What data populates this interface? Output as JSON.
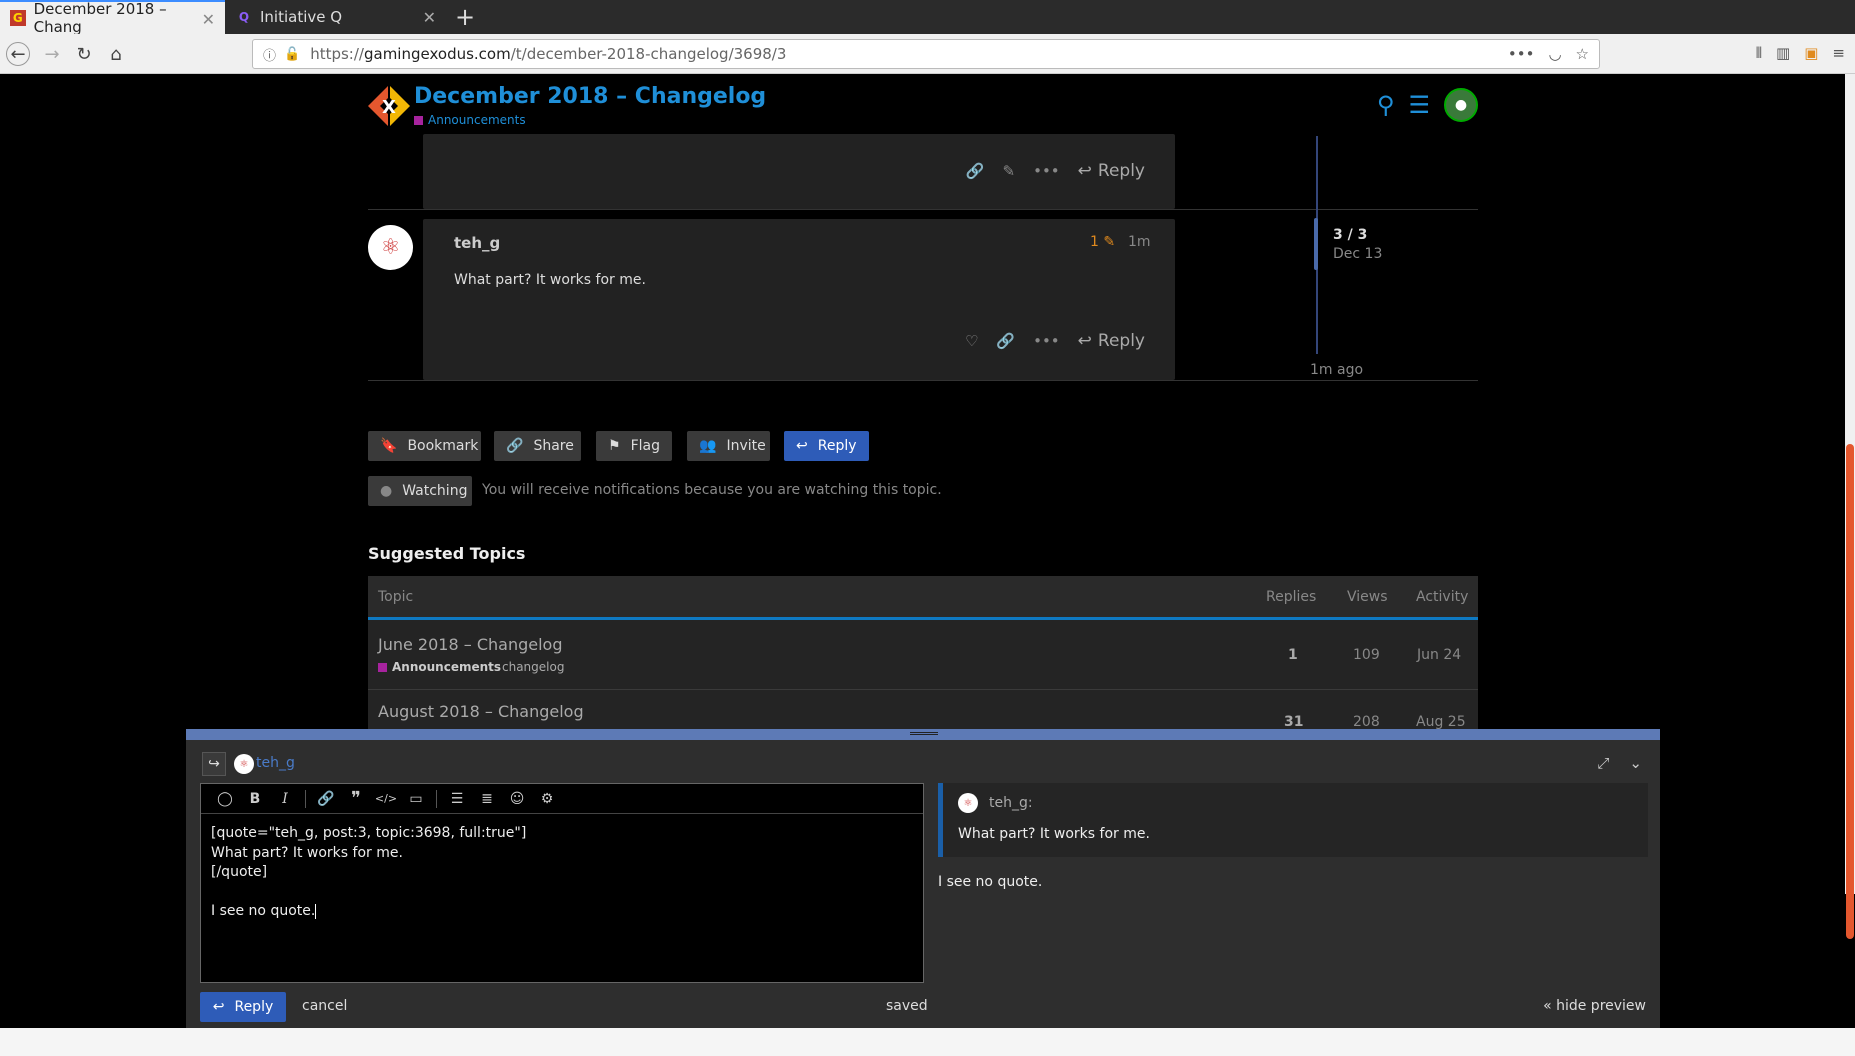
{
  "browser": {
    "tabs": [
      {
        "title": "December 2018 – Chang",
        "active": true,
        "favicon": "gx-icon"
      },
      {
        "title": "Initiative Q",
        "active": false,
        "favicon": "q-icon"
      }
    ],
    "url_prefix": "https://",
    "url_host": "gamingexodus.com",
    "url_path": "/t/december-2018-changelog/3698/3"
  },
  "header": {
    "title": "December 2018 – Changelog",
    "category": "Announcements",
    "category_color": "#a7239e"
  },
  "prev_post": {
    "reply_label": "Reply"
  },
  "post": {
    "username": "teh_g",
    "edit_count": "1",
    "age": "1m",
    "text": "What part? It works for me.",
    "reply_label": "Reply"
  },
  "timeline": {
    "count": "3 / 3",
    "date": "Dec 13",
    "ago": "1m ago"
  },
  "topic_buttons": {
    "bookmark": "Bookmark",
    "share": "Share",
    "flag": "Flag",
    "invite": "Invite",
    "reply": "Reply"
  },
  "notifications": {
    "level": "Watching",
    "message": "You will receive notifications because you are watching this topic."
  },
  "suggested": {
    "title": "Suggested Topics",
    "columns": {
      "topic": "Topic",
      "replies": "Replies",
      "views": "Views",
      "activity": "Activity"
    },
    "rows": [
      {
        "title": "June 2018 – Changelog",
        "category": "Announcements",
        "tag": "changelog",
        "replies": "1",
        "views": "109",
        "activity": "Jun 24"
      },
      {
        "title": "August 2018 – Changelog",
        "replies": "31",
        "views": "208",
        "activity": "Aug 25"
      }
    ]
  },
  "composer": {
    "reply_to_user": "teh_g",
    "editor_lines": [
      "[quote=\"teh_g, post:3, topic:3698, full:true\"]",
      "What part? It works for me.",
      "[/quote]",
      "",
      "I see no quote."
    ],
    "preview": {
      "quote_user": "teh_g:",
      "quote_text": "What part? It works for me.",
      "body": "I see no quote."
    },
    "reply_label": "Reply",
    "cancel_label": "cancel",
    "saved_label": "saved",
    "hide_preview_label": "« hide preview"
  }
}
